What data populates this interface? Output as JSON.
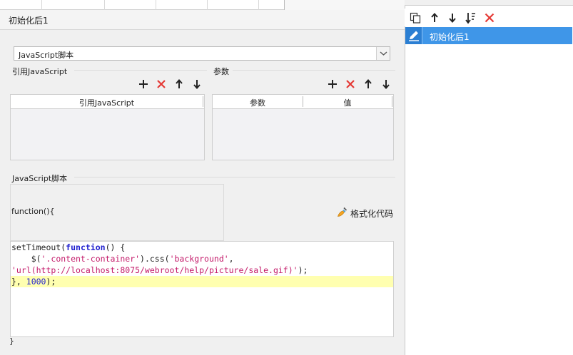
{
  "panel": {
    "title": "初始化后1",
    "script_type": "JavaScript脚本"
  },
  "ref_js": {
    "section_label": "引用JavaScript",
    "columns": [
      "引用JavaScript"
    ]
  },
  "params": {
    "section_label": "参数",
    "columns": [
      "参数",
      "值"
    ]
  },
  "script": {
    "section_label": "JavaScript脚本",
    "func_header": "function(){",
    "format_button": "格式化代码",
    "closing": "}",
    "code": {
      "l1_fn": "setTimeout(",
      "l1_kw": "function",
      "l1_rest": "() {",
      "l2_a": "    $(",
      "l2_s1": "'.content-container'",
      "l2_b": ").css(",
      "l2_s2": "'background'",
      "l2_c": ",",
      "l3_s": "'url(http://localhost:8075/webroot/help/picture/sale.gif)'",
      "l3_c": ");",
      "l4_a": "}, ",
      "l4_num": "1000",
      "l4_b": ");"
    }
  },
  "toolbar_icons": [
    "add-icon",
    "delete-icon",
    "move-up-icon",
    "move-down-icon"
  ],
  "right_panel": {
    "toolbar_icons": [
      "copy-icon",
      "move-up-icon",
      "move-down-icon",
      "sort-icon",
      "delete-icon"
    ],
    "selected_item": "初始化后1"
  },
  "colors": {
    "accent_blue": "#3f96e8",
    "delete_red": "#e53935",
    "keyword_blue": "#1f1fcf",
    "string_magenta": "#c41a6a",
    "highlight_yellow": "#ffffb0"
  }
}
